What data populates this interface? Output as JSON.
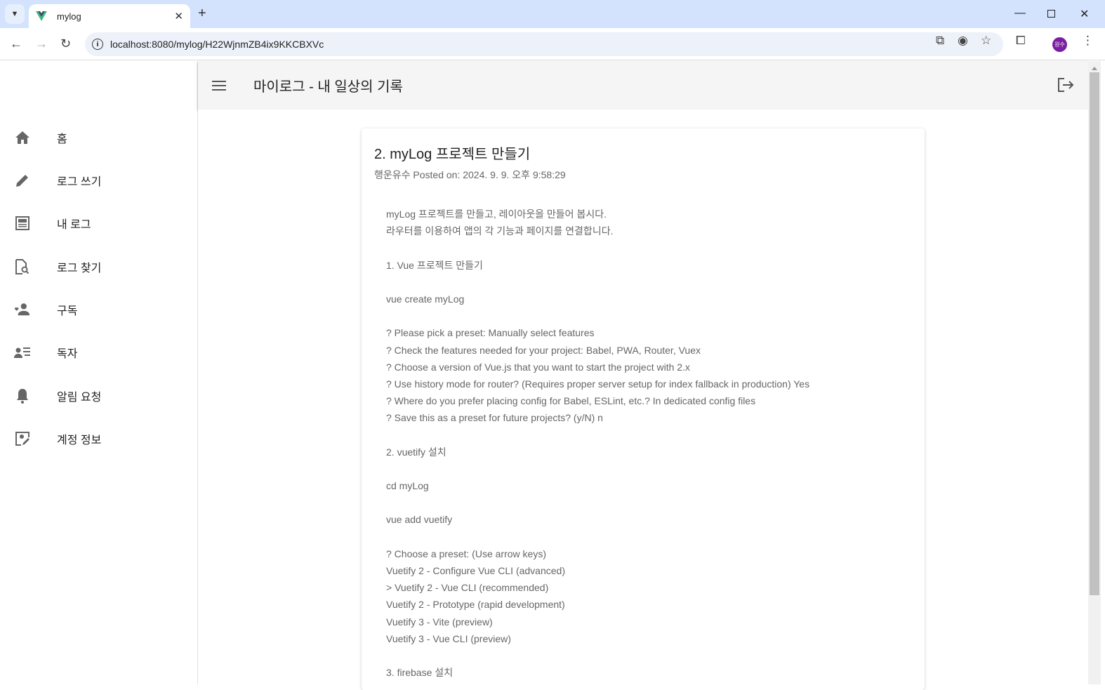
{
  "browser": {
    "tab_title": "mylog",
    "url": "localhost:8080/mylog/H22WjnmZB4ix9KKCBXVc",
    "profile": "원수"
  },
  "sidebar": {
    "items": [
      {
        "label": "홈",
        "icon": "home-icon"
      },
      {
        "label": "로그 쓰기",
        "icon": "pencil-icon"
      },
      {
        "label": "내 로그",
        "icon": "article-icon"
      },
      {
        "label": "로그 찾기",
        "icon": "file-search-icon"
      },
      {
        "label": "구독",
        "icon": "subscribe-icon"
      },
      {
        "label": "독자",
        "icon": "readers-icon"
      },
      {
        "label": "알림 요청",
        "icon": "bell-icon"
      },
      {
        "label": "계정 정보",
        "icon": "account-edit-icon"
      }
    ]
  },
  "appbar": {
    "title": "마이로그 - 내 일상의 기록"
  },
  "post": {
    "title": "2. myLog 프로젝트 만들기",
    "meta": "행운유수 Posted on: 2024. 9. 9. 오후 9:58:29",
    "lines": [
      "myLog 프로젝트를 만들고, 레이아웃을 만들어 봅시다.",
      "라우터를 이용하여 앱의 각 기능과 페이지를 연결합니다.",
      "",
      "1. Vue 프로젝트 만들기",
      "",
      "vue create myLog",
      "",
      "? Please pick a preset: Manually select features",
      "? Check the features needed for your project: Babel, PWA, Router, Vuex",
      "? Choose a version of Vue.js that you want to start the project with 2.x",
      "? Use history mode for router? (Requires proper server setup for index fallback in production) Yes",
      "? Where do you prefer placing config for Babel, ESLint, etc.? In dedicated config files",
      "? Save this as a preset for future projects? (y/N) n",
      "",
      "2. vuetify 설치",
      "",
      "cd myLog",
      "",
      "vue add vuetify",
      "",
      "? Choose a preset: (Use arrow keys)",
      "Vuetify 2 - Configure Vue CLI (advanced)",
      "> Vuetify 2 - Vue CLI (recommended)",
      "Vuetify 2 - Prototype (rapid development)",
      "Vuetify 3 - Vite (preview)",
      "Vuetify 3 - Vue CLI (preview)",
      "",
      "3. firebase 설치"
    ]
  }
}
